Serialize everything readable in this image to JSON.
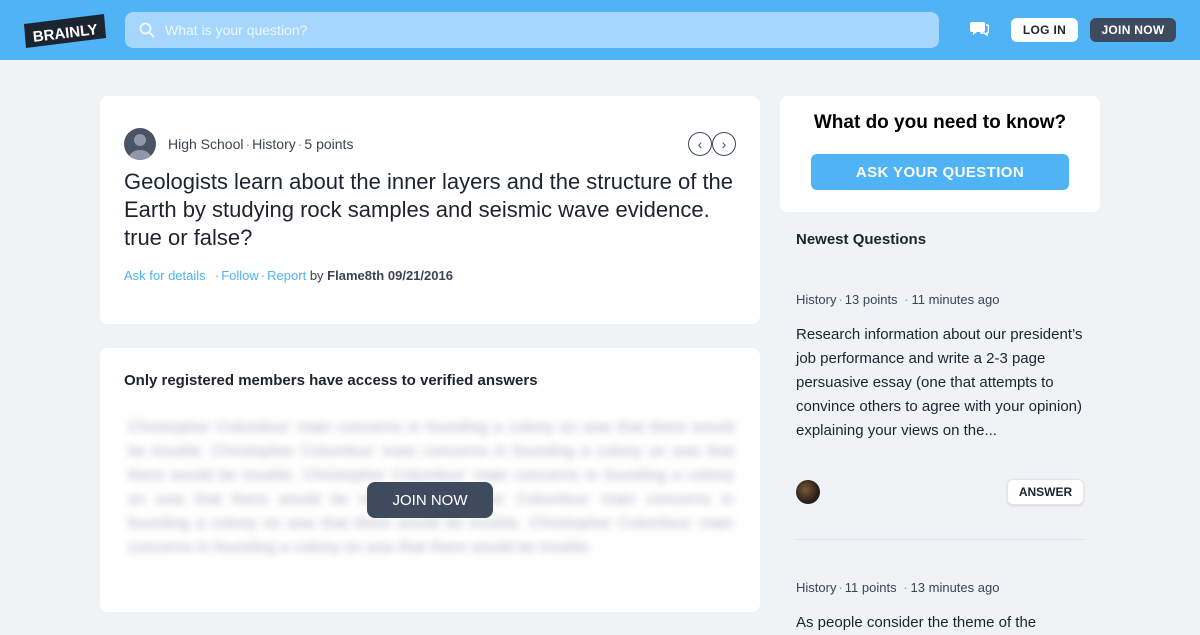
{
  "header": {
    "logo_text": "BRAINLY",
    "search_placeholder": "What is your question?",
    "login_label": "LOG IN",
    "join_label": "JOIN NOW"
  },
  "question": {
    "level": "High School",
    "subject": "History",
    "points": "5 points",
    "text": "Geologists learn about the inner layers and the structure of the Earth by studying rock samples and seismic wave evidence. true or false?",
    "actions": {
      "ask_details": "Ask for details",
      "follow": "Follow",
      "report": "Report",
      "by_label": "by",
      "author": "Flame8th",
      "date": "09/21/2016"
    }
  },
  "answer_gate": {
    "heading": "Only registered members have access to verified answers",
    "blurred_text": "Christopher Columbus' main concerns in founding a colony on was that there would be trouble. Christopher Columbus' main concerns in founding a colony on was that there would be trouble. Christopher Columbus' main concerns in founding a colony on was that there would be trouble. Christopher Columbus' main concerns in founding a colony on was that there would be trouble. Christopher Columbus' main concerns in founding a colony on was that there would be trouble.",
    "join_label": "JOIN NOW"
  },
  "sidebar": {
    "ask_title": "What do you need to know?",
    "ask_button": "ASK YOUR QUESTION",
    "newest_title": "Newest Questions",
    "questions": [
      {
        "subject": "History",
        "points": "13 points",
        "time": "11 minutes ago",
        "text": "Research information about our president’s job performance and write a 2-3 page persuasive essay (one that attempts to convince others to agree with your opinion) explaining your views on the...",
        "answer_label": "ANSWER"
      },
      {
        "subject": "History",
        "points": "11 points",
        "time": "13 minutes ago",
        "text": "As people consider the theme of the"
      }
    ]
  },
  "colors": {
    "brand_blue": "#4fb3f6",
    "dark_slate": "#3e4a5e",
    "page_bg": "#f0f3f6"
  }
}
